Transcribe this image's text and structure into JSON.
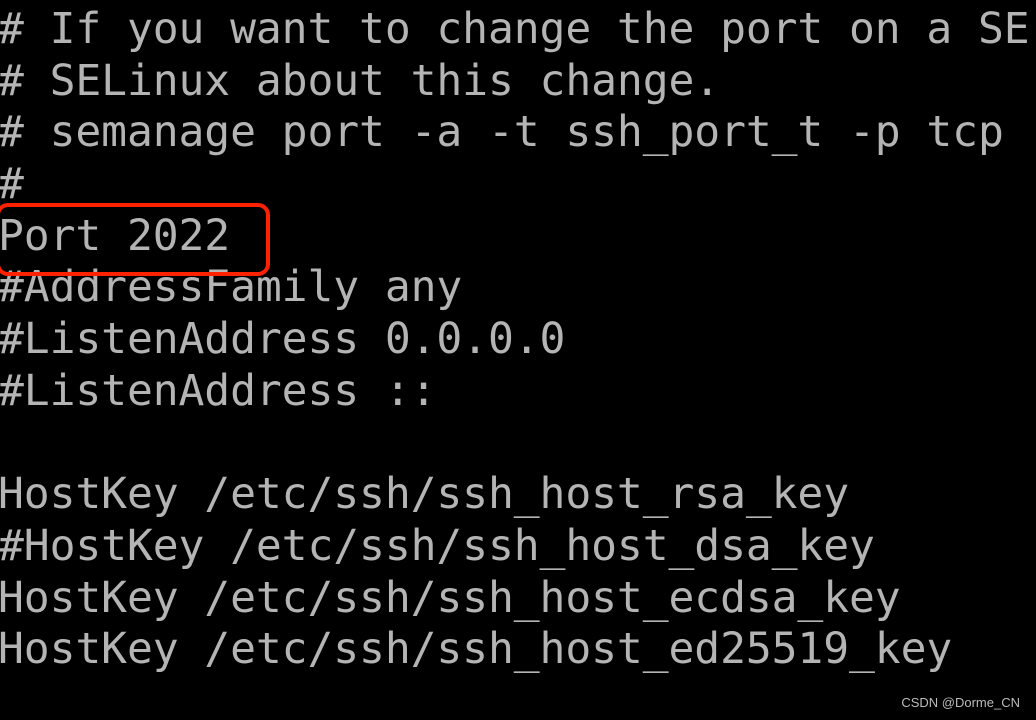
{
  "terminal": {
    "lines": [
      "# If you want to change the port on a SE",
      "# SELinux about this change.",
      "# semanage port -a -t ssh_port_t -p tcp",
      "#",
      "Port 2022",
      "#AddressFamily any",
      "#ListenAddress 0.0.0.0",
      "#ListenAddress ::",
      "",
      "HostKey /etc/ssh/ssh_host_rsa_key",
      "#HostKey /etc/ssh/ssh_host_dsa_key",
      "HostKey /etc/ssh/ssh_host_ecdsa_key",
      "HostKey /etc/ssh/ssh_host_ed25519_key"
    ],
    "text_color": "#b4b4b4",
    "background": "#000000"
  },
  "highlight": {
    "color": "#ff2200",
    "target_line": "Port 2022"
  },
  "watermark": "CSDN @Dorme_CN"
}
